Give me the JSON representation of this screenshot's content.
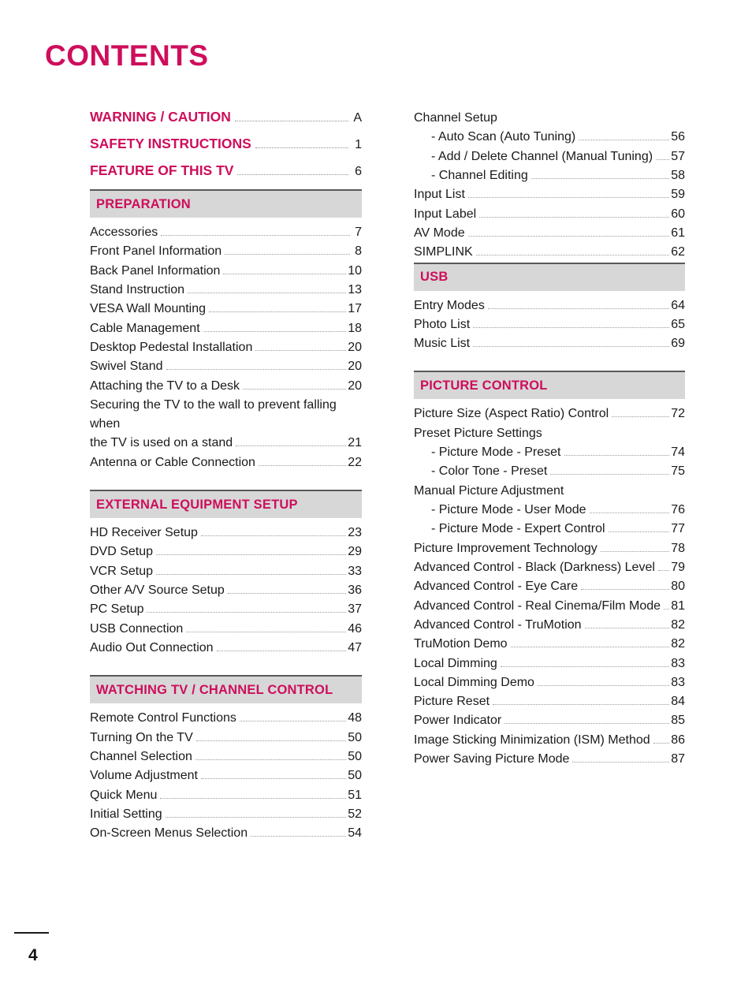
{
  "page": {
    "title": "CONTENTS",
    "number": "4",
    "accent_color": "#ce0e5c",
    "band_color": "#d7d7d7",
    "rule_color": "#59595b"
  },
  "toplevel": [
    {
      "label": "WARNING / CAUTION",
      "page": "A"
    },
    {
      "label": "SAFETY INSTRUCTIONS",
      "page": "1"
    },
    {
      "label": "FEATURE OF THIS TV",
      "page": "6"
    }
  ],
  "left_sections": [
    {
      "title": "PREPARATION",
      "entries": [
        {
          "label": "Accessories",
          "page": "7"
        },
        {
          "label": "Front Panel Information",
          "page": "8"
        },
        {
          "label": "Back Panel Information",
          "page": "10"
        },
        {
          "label": "Stand Instruction",
          "page": "13"
        },
        {
          "label": "VESA Wall Mounting",
          "page": "17"
        },
        {
          "label": "Cable Management",
          "page": "18"
        },
        {
          "label": "Desktop Pedestal Installation",
          "page": "20"
        },
        {
          "label": "Swivel Stand",
          "page": "20"
        },
        {
          "label": "Attaching the TV to a Desk",
          "page": "20"
        },
        {
          "label": "Securing the TV to the wall to prevent falling when",
          "label2": "the TV is used on a stand",
          "page": "21",
          "wrap": true
        },
        {
          "label": "Antenna or Cable Connection",
          "page": "22"
        }
      ]
    },
    {
      "title": "EXTERNAL EQUIPMENT SETUP",
      "entries": [
        {
          "label": "HD Receiver Setup",
          "page": "23"
        },
        {
          "label": "DVD Setup",
          "page": "29"
        },
        {
          "label": "VCR Setup",
          "page": "33"
        },
        {
          "label": "Other A/V Source Setup",
          "page": "36"
        },
        {
          "label": "PC Setup",
          "page": "37"
        },
        {
          "label": "USB Connection",
          "page": "46"
        },
        {
          "label": "Audio Out Connection",
          "page": "47"
        }
      ]
    },
    {
      "title": "WATCHING TV / CHANNEL CONTROL",
      "entries": [
        {
          "label": "Remote Control Functions",
          "page": "48"
        },
        {
          "label": "Turning On the TV",
          "page": "50"
        },
        {
          "label": "Channel Selection",
          "page": "50"
        },
        {
          "label": "Volume Adjustment",
          "page": "50"
        },
        {
          "label": "Quick Menu",
          "page": "51"
        },
        {
          "label": "Initial Setting",
          "page": "52"
        },
        {
          "label": "On-Screen Menus Selection",
          "page": "54"
        }
      ]
    }
  ],
  "right_continued": [
    {
      "label": "Channel Setup",
      "page": "",
      "noleader": true
    },
    {
      "label": "- Auto Scan (Auto Tuning)",
      "page": "56",
      "sub": true
    },
    {
      "label": "- Add / Delete Channel (Manual Tuning)",
      "page": "57",
      "sub": true
    },
    {
      "label": "- Channel Editing",
      "page": "58",
      "sub": true
    },
    {
      "label": "Input List",
      "page": "59"
    },
    {
      "label": "Input Label",
      "page": "60"
    },
    {
      "label": "AV Mode",
      "page": "61"
    },
    {
      "label": "SIMPLINK",
      "page": "62"
    }
  ],
  "right_sections": [
    {
      "title": "USB",
      "entries": [
        {
          "label": "Entry Modes",
          "page": "64"
        },
        {
          "label": "Photo List",
          "page": "65"
        },
        {
          "label": "Music List",
          "page": "69"
        }
      ]
    },
    {
      "title": "PICTURE CONTROL",
      "entries": [
        {
          "label": "Picture Size (Aspect Ratio) Control",
          "page": "72"
        },
        {
          "label": "Preset Picture Settings",
          "page": "",
          "noleader": true
        },
        {
          "label": "- Picture Mode - Preset",
          "page": "74",
          "sub": true
        },
        {
          "label": "- Color Tone - Preset",
          "page": "75",
          "sub": true
        },
        {
          "label": "Manual Picture Adjustment",
          "page": "",
          "noleader": true
        },
        {
          "label": "- Picture Mode - User Mode",
          "page": "76",
          "sub": true
        },
        {
          "label": "- Picture Mode - Expert Control",
          "page": "77",
          "sub": true
        },
        {
          "label": "Picture Improvement Technology",
          "page": "78"
        },
        {
          "label": "Advanced Control - Black (Darkness) Level",
          "page": "79"
        },
        {
          "label": "Advanced Control - Eye Care",
          "page": "80"
        },
        {
          "label": "Advanced Control - Real Cinema/Film Mode",
          "page": "81"
        },
        {
          "label": "Advanced Control - TruMotion",
          "page": "82"
        },
        {
          "label": "TruMotion Demo",
          "page": "82"
        },
        {
          "label": "Local Dimming",
          "page": "83"
        },
        {
          "label": "Local Dimming Demo",
          "page": "83"
        },
        {
          "label": "Picture Reset",
          "page": "84"
        },
        {
          "label": "Power Indicator",
          "page": "85"
        },
        {
          "label": "Image Sticking Minimization (ISM) Method",
          "page": "86"
        },
        {
          "label": "Power Saving Picture Mode",
          "page": "87"
        }
      ]
    }
  ]
}
